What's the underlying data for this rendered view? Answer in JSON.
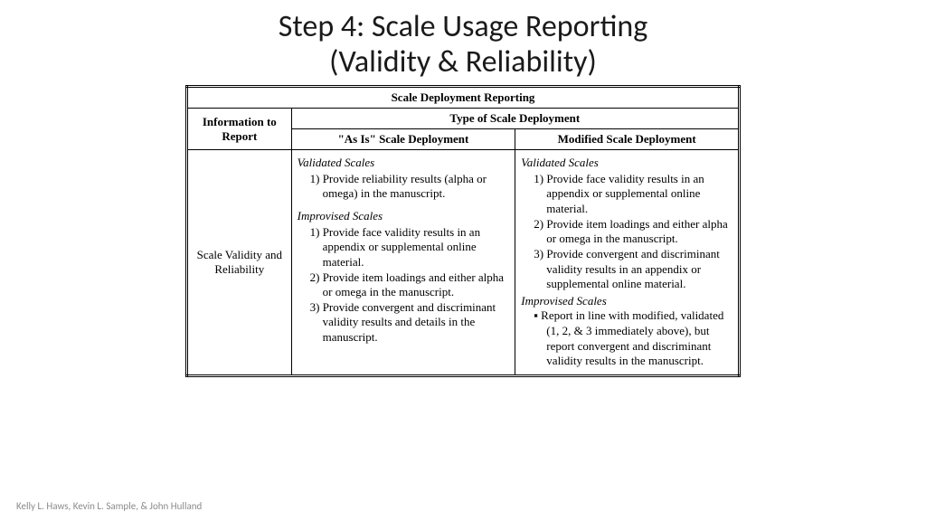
{
  "title_line1": "Step 4: Scale Usage Reporting",
  "title_line2": "(Validity & Reliability)",
  "table": {
    "title": "Scale Deployment Reporting",
    "info_header": "Information to Report",
    "type_header": "Type of Scale Deployment",
    "col_asis": "\"As Is\" Scale Deployment",
    "col_mod": "Modified Scale Deployment",
    "row_label": "Scale Validity and Reliability",
    "asis": {
      "validated_header": "Validated Scales",
      "validated_items": {
        "i1": "1) Provide reliability results (alpha or omega) in the manuscript."
      },
      "improv_header": "Improvised Scales",
      "improv_items": {
        "i1": "1) Provide face validity results in an appendix or supplemental online material.",
        "i2": "2) Provide item loadings and either alpha or omega in the manuscript.",
        "i3": "3) Provide convergent and discriminant validity results and details in the manuscript."
      }
    },
    "mod": {
      "validated_header": "Validated Scales",
      "validated_items": {
        "i1": "1) Provide face validity results in an appendix or supplemental online material.",
        "i2": "2) Provide item loadings and either alpha or omega in the manuscript.",
        "i3": "3) Provide convergent and discriminant validity results in an appendix or supplemental online material."
      },
      "improv_header": "Improvised Scales",
      "improv_items": {
        "i1": "▪ Report in line with modified, validated (1, 2, & 3 immediately above), but report convergent and discriminant validity results in the manuscript."
      }
    }
  },
  "footer": "Kelly L. Haws, Kevin L. Sample, & John Hulland"
}
